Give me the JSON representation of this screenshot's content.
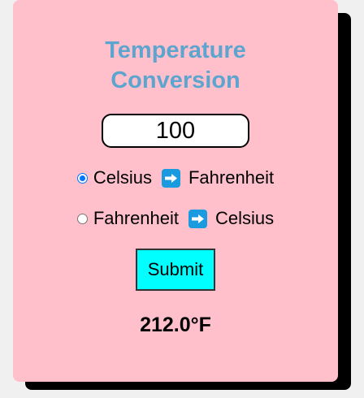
{
  "title_line1": "Temperature",
  "title_line2": "Conversion",
  "input": {
    "value": "100"
  },
  "options": {
    "c2f": {
      "from": "Celsius",
      "to": "Fahrenheit",
      "checked": true
    },
    "f2c": {
      "from": "Fahrenheit",
      "to": "Celsius",
      "checked": false
    }
  },
  "arrow_icon": "right-arrow-emoji",
  "submit_label": "Submit",
  "result": "212.0°F",
  "colors": {
    "card": "#ffc0cb",
    "title": "#5da5cf",
    "submit": "#00ffff",
    "arrow": "#1a9be0"
  }
}
